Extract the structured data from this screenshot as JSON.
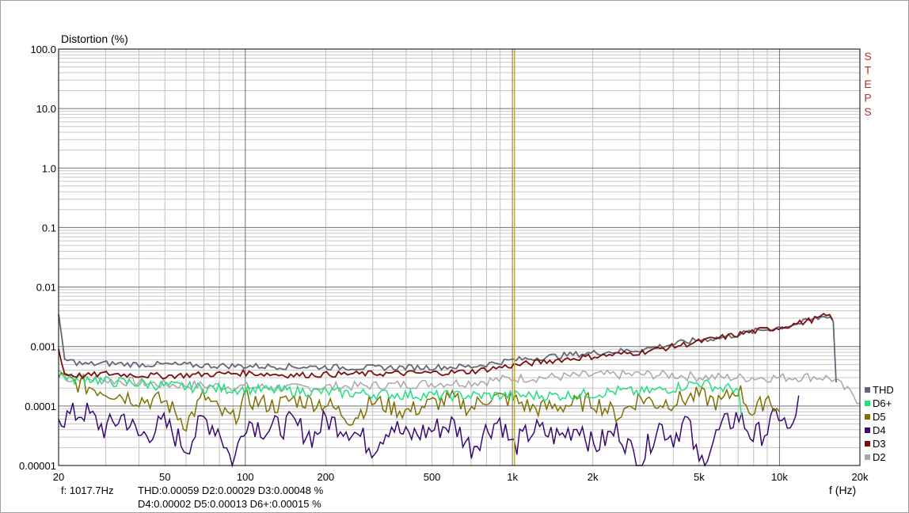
{
  "chart_data": {
    "type": "line",
    "ylabel": "Distortion (%)",
    "xlabel": "f (Hz)",
    "x_scale": "log",
    "y_scale": "log",
    "xlim": [
      20,
      20000
    ],
    "ylim": [
      1e-05,
      100
    ],
    "y_ticks": [
      {
        "value": 100,
        "label": "100.0"
      },
      {
        "value": 10,
        "label": "10.0"
      },
      {
        "value": 1,
        "label": "1.0"
      },
      {
        "value": 0.1,
        "label": "0.1"
      },
      {
        "value": 0.01,
        "label": "0.01"
      },
      {
        "value": 0.001,
        "label": "0.001"
      },
      {
        "value": 0.0001,
        "label": "0.0001"
      },
      {
        "value": 1e-05,
        "label": "0.00001"
      }
    ],
    "x_ticks": [
      {
        "value": 20,
        "label": "20"
      },
      {
        "value": 50,
        "label": "50"
      },
      {
        "value": 100,
        "label": "100"
      },
      {
        "value": 200,
        "label": "200"
      },
      {
        "value": 500,
        "label": "500"
      },
      {
        "value": 1000,
        "label": "1k"
      },
      {
        "value": 2000,
        "label": "2k"
      },
      {
        "value": 5000,
        "label": "5k"
      },
      {
        "value": 10000,
        "label": "10k"
      },
      {
        "value": 20000,
        "label": "20k"
      }
    ],
    "grid": true,
    "cursor_x": 1017.7,
    "side_label": "STEPS",
    "legend_position": "right-bottom",
    "series": [
      {
        "name": "THD",
        "color": "#606878",
        "x": [
          20,
          21,
          23,
          25,
          30,
          40,
          50,
          70,
          100,
          150,
          200,
          300,
          500,
          700,
          1000,
          1500,
          2000,
          3000,
          4000,
          5000,
          6000,
          7000,
          8000,
          10000,
          12000,
          14000,
          15000,
          15500,
          16000,
          16300
        ],
        "y": [
          0.0035,
          0.0006,
          0.00055,
          0.0005,
          0.00052,
          0.0005,
          0.0005,
          0.00048,
          0.00047,
          0.00046,
          0.00045,
          0.00044,
          0.00045,
          0.00046,
          0.00059,
          0.0007,
          0.00078,
          0.00088,
          0.0011,
          0.0013,
          0.0014,
          0.0016,
          0.0018,
          0.0021,
          0.0025,
          0.003,
          0.0033,
          0.0032,
          0.0025,
          0.00025
        ]
      },
      {
        "name": "D3",
        "color": "#7a1010",
        "x": [
          20,
          21,
          23,
          25,
          30,
          40,
          50,
          70,
          100,
          150,
          200,
          300,
          500,
          700,
          1000,
          1500,
          2000,
          3000,
          4000,
          5000,
          6000,
          7000,
          8000,
          10000,
          12000,
          14000,
          15000,
          15500,
          15800
        ],
        "y": [
          0.0009,
          0.00035,
          0.00033,
          0.00032,
          0.00035,
          0.00033,
          0.00032,
          0.00034,
          0.00036,
          0.00033,
          0.00034,
          0.00035,
          0.00036,
          0.00038,
          0.00048,
          0.0006,
          0.00068,
          0.0008,
          0.001,
          0.0012,
          0.0014,
          0.0016,
          0.0018,
          0.0021,
          0.0025,
          0.003,
          0.0033,
          0.0032,
          0.0028
        ]
      },
      {
        "name": "D2",
        "color": "#a8a8a8",
        "x": [
          20,
          22,
          25,
          30,
          40,
          50,
          70,
          100,
          150,
          200,
          300,
          500,
          700,
          1000,
          1500,
          2000,
          3000,
          4000,
          5000,
          7000,
          10000,
          13000,
          15000,
          16000,
          17000,
          18000,
          19000,
          20000
        ],
        "y": [
          0.0004,
          0.00028,
          0.0003,
          0.00027,
          0.00025,
          0.00023,
          0.00022,
          0.00021,
          0.0002,
          0.00021,
          0.00022,
          0.00024,
          0.00025,
          0.00029,
          0.00031,
          0.00033,
          0.00034,
          0.00033,
          0.00031,
          0.0003,
          0.0003,
          0.00031,
          0.0003,
          0.00028,
          0.00022,
          0.00018,
          0.00015,
          0.00011
        ]
      },
      {
        "name": "D6+",
        "color": "#20e080",
        "x": [
          20,
          23,
          25,
          30,
          40,
          50,
          70,
          100,
          150,
          200,
          300,
          500,
          700,
          1000,
          1500,
          2000,
          2500,
          3000,
          4000,
          5000,
          6000,
          7000,
          7200
        ],
        "y": [
          0.00033,
          0.00028,
          0.0003,
          0.00026,
          0.00024,
          0.00022,
          0.0002,
          0.00019,
          0.00018,
          0.00017,
          0.00016,
          0.00015,
          0.00015,
          0.00015,
          0.00015,
          0.00016,
          0.00018,
          0.00017,
          0.0002,
          0.00025,
          0.0002,
          0.0002,
          7e-05
        ]
      },
      {
        "name": "D5",
        "color": "#807000",
        "x": [
          20,
          25,
          30,
          40,
          50,
          60,
          70,
          80,
          90,
          100,
          130,
          150,
          200,
          250,
          300,
          400,
          500,
          600,
          700,
          800,
          1000,
          1200,
          1500,
          2000,
          2500,
          3000,
          3500,
          4000,
          5000,
          6000,
          7000,
          8000,
          9000,
          10000
        ],
        "y": [
          0.0003,
          0.00022,
          0.00018,
          0.00013,
          0.00012,
          5e-05,
          0.00015,
          8e-05,
          6e-05,
          0.00013,
          0.0001,
          0.00013,
          0.00011,
          6e-05,
          0.00012,
          8e-05,
          0.00011,
          0.00013,
          9e-05,
          0.00014,
          0.00013,
          9e-05,
          0.0001,
          0.00012,
          7e-05,
          0.00014,
          0.00011,
          0.00012,
          0.00015,
          0.00011,
          0.0002,
          7e-05,
          0.00015,
          8e-05
        ]
      },
      {
        "name": "D4",
        "color": "#3a0a70",
        "x": [
          20,
          25,
          30,
          35,
          40,
          50,
          60,
          70,
          80,
          90,
          100,
          120,
          150,
          180,
          200,
          250,
          300,
          350,
          400,
          500,
          600,
          700,
          800,
          900,
          1000,
          1200,
          1500,
          1800,
          2000,
          2500,
          3000,
          3500,
          4000,
          4500,
          5000,
          6000,
          7000,
          8000,
          9000,
          10000,
          11000,
          11800
        ],
        "y": [
          6e-05,
          8e-05,
          4e-05,
          7e-05,
          3e-05,
          5e-05,
          2e-05,
          6e-05,
          4e-05,
          1e-05,
          6e-05,
          4e-05,
          5e-05,
          3e-05,
          6e-05,
          4e-05,
          2e-05,
          5e-05,
          3e-05,
          4e-05,
          5e-05,
          2e-05,
          4e-05,
          6e-05,
          2e-05,
          4e-05,
          3e-05,
          5e-05,
          2e-05,
          4e-05,
          1e-05,
          5e-05,
          3e-05,
          6e-05,
          1e-05,
          4e-05,
          7e-05,
          3e-05,
          4e-05,
          8e-05,
          3e-05,
          0.00015
        ]
      }
    ],
    "legend": [
      {
        "name": "THD",
        "color": "#606878"
      },
      {
        "name": "D6+",
        "color": "#20e080"
      },
      {
        "name": "D5",
        "color": "#807000"
      },
      {
        "name": "D4",
        "color": "#3a0a70"
      },
      {
        "name": "D3",
        "color": "#7a1010"
      },
      {
        "name": "D2",
        "color": "#a8a8a8"
      }
    ]
  },
  "readout": {
    "freq": "f: 1017.7Hz",
    "line1": "THD:0.00059  D2:0.00029  D3:0.00048 %",
    "line2": "D4:0.00002  D5:0.00013  D6+:0.00015 %"
  }
}
